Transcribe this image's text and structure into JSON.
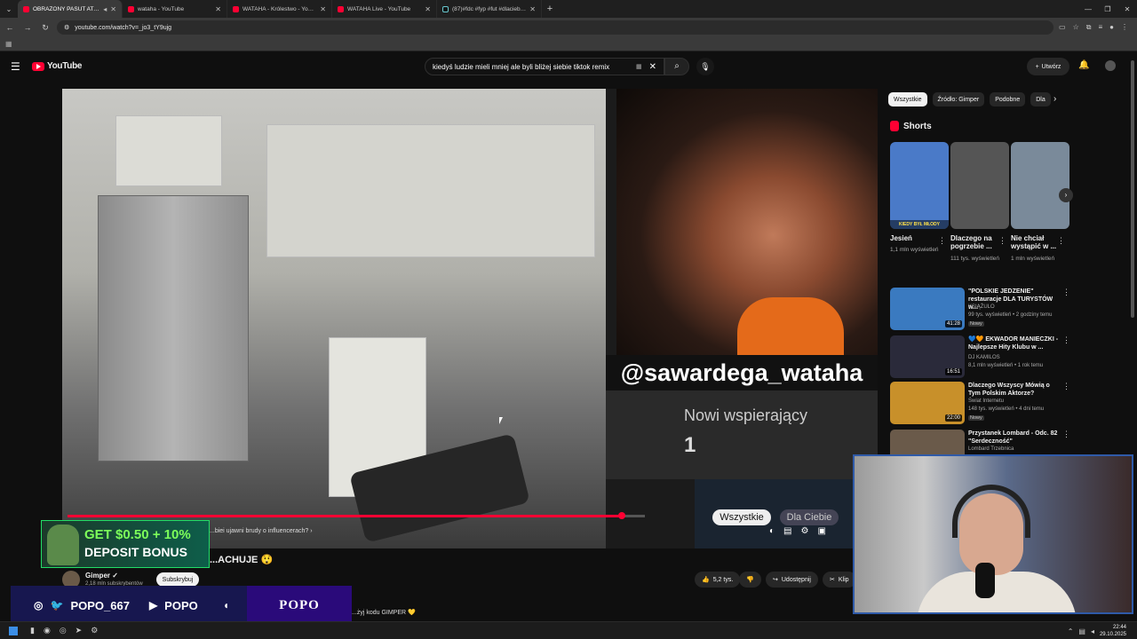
{
  "browser": {
    "tabs": [
      {
        "title": "OBRAŻONY PASUT ATAKUJE",
        "active": true,
        "favicon": "youtube"
      },
      {
        "title": "wataha - YouTube",
        "active": false,
        "favicon": "youtube"
      },
      {
        "title": "WATAHA - Królestwo - YouTube",
        "active": false,
        "favicon": "youtube"
      },
      {
        "title": "WATAHA Live - YouTube",
        "active": false,
        "favicon": "youtube"
      },
      {
        "title": "(87)#fdc #fyp #fut #dlaciebie #...",
        "active": false,
        "favicon": "tiktok"
      }
    ],
    "url": "youtube.com/watch?v=_jo3_tY9ujg"
  },
  "youtube": {
    "logo": "YouTube",
    "search_query": "kiedyś ludzie mieli mniej ale byli bliżej siebie tiktok remix",
    "create_label": "Utwórz"
  },
  "player": {
    "overlay_handle": "@sawardega_wataha",
    "supporters_label": "Nowi wspierający",
    "supporters_count": "1",
    "pill_all": "Wszystkie",
    "pill_for_you": "Dla Ciebie",
    "chapter": "...biei ujawni brudy o influencerach?",
    "progress_played": 0.96,
    "progress_knob": 0.96
  },
  "video": {
    "title": "...ACHUJE 😲",
    "channel": "Gimper",
    "subscribers": "2,18 mln subskrybentów",
    "subscribe_label": "Subskrybuj",
    "likes": "5,2 tys.",
    "share_label": "Udostępnij",
    "clip_label": "Klip",
    "description_line": "...żyj kodu GIMPER 💛"
  },
  "stream_overlay": {
    "ad_line1": "GET $0.50 + 10%",
    "ad_line2": "DEPOSIT BONUS",
    "social_handle": "POPO_667",
    "youtube_handle": "POPO",
    "brand": "POPO"
  },
  "sidebar": {
    "chips": [
      "Wszystkie",
      "Źródło: Gimper",
      "Podobne",
      "Dla"
    ],
    "shorts_title": "Shorts",
    "shorts": [
      {
        "title": "Jesień",
        "views": "1,1 mln wyświetleń",
        "caption": "KIEDY BYŁ MŁODY",
        "color": "#4a7ac8"
      },
      {
        "title": "Dlaczego na pogrzebie ...",
        "views": "111 tys. wyświetleń",
        "caption": "",
        "color": "#555555"
      },
      {
        "title": "Nie chciał wystąpić w ...",
        "views": "1 mln wyświetleń",
        "caption": "",
        "color": "#7a8a9a"
      }
    ],
    "recommended": [
      {
        "title": "\"POLSKIE JEDZENIE\" restauracje DLA TURYSTÓW w...",
        "channel": "KSIĄŻULO",
        "meta": "99 tys. wyświetleń • 2 godziny temu",
        "badge": "Nowy",
        "duration": "41:28",
        "color": "#3a7ac0"
      },
      {
        "title": "💙🧡 EKWADOR MANIECZKI - Najlepsze Hity Klubu w ...",
        "channel": "DJ KAMILOS",
        "meta": "8,1 mln wyświetleń • 1 rok temu",
        "badge": "",
        "duration": "16:51",
        "color": "#2a2a3a"
      },
      {
        "title": "Dlaczego Wszyscy Mówią o Tym Polskim Aktorze?",
        "channel": "Świat Internetu",
        "meta": "148 tys. wyświetleń • 4 dni temu",
        "badge": "Nowy",
        "duration": "22:00",
        "color": "#c8902a"
      },
      {
        "title": "Przystanek Lombard - Odc. 82 \"Serdeczność\"",
        "channel": "Lombard Trzebnica",
        "meta": "",
        "badge": "",
        "duration": "",
        "color": "#6a5a4a"
      }
    ]
  },
  "taskbar": {
    "time": "22:44",
    "date": "29.10.2025"
  }
}
